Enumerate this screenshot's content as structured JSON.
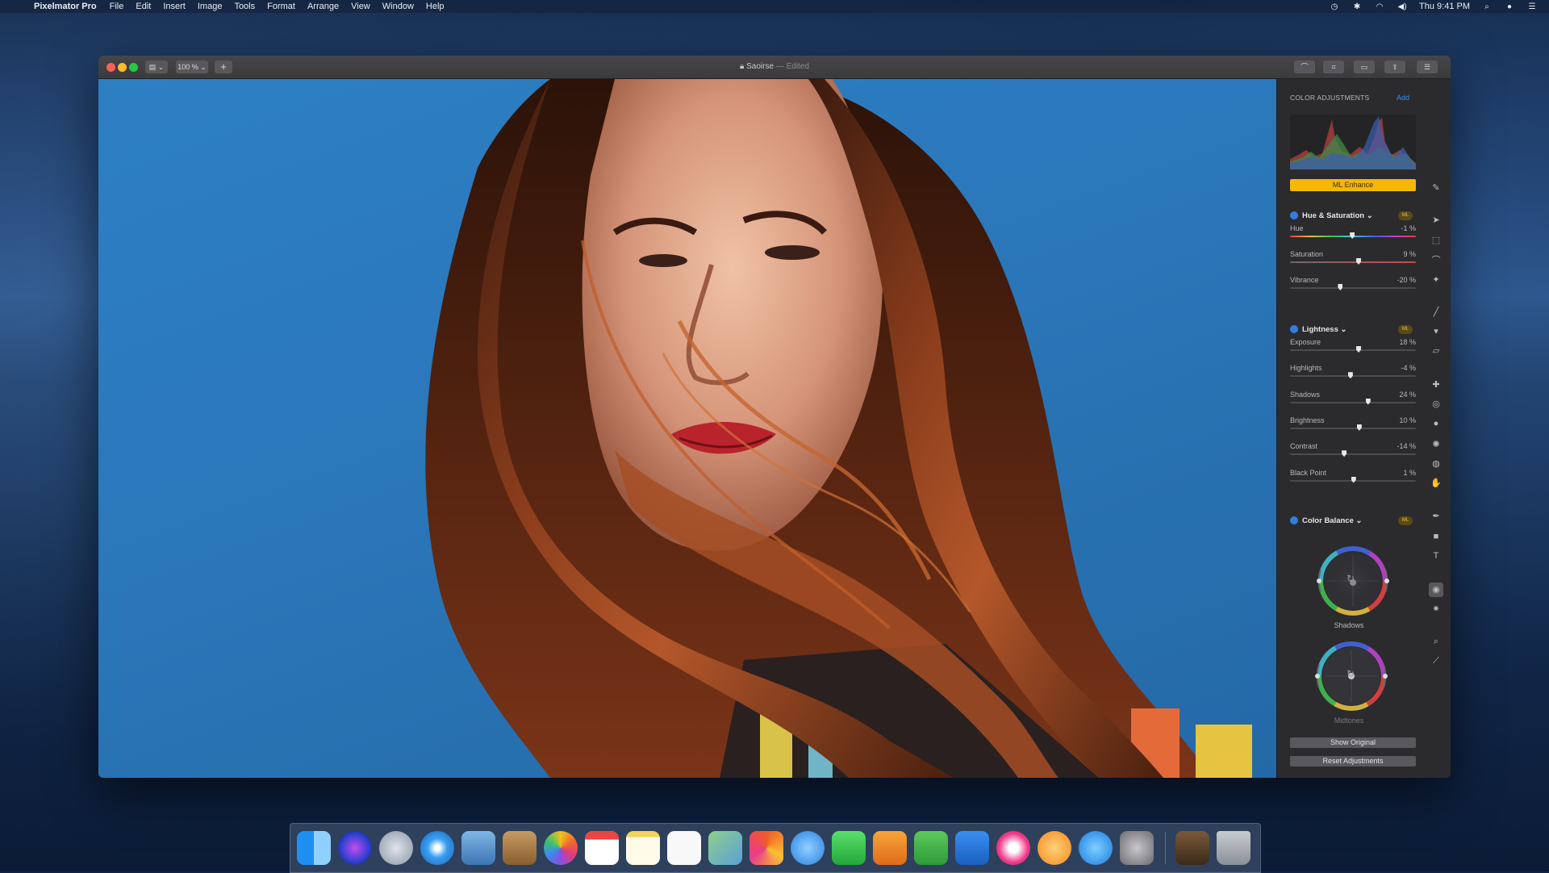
{
  "menubar": {
    "app_name": "Pixelmator Pro",
    "items": [
      "File",
      "Edit",
      "Insert",
      "Image",
      "Tools",
      "Format",
      "Arrange",
      "View",
      "Window",
      "Help"
    ],
    "clock": "Thu 9:41 PM"
  },
  "window": {
    "zoom": "100 %",
    "title": "Saoirse",
    "title_status": "— Edited"
  },
  "panel": {
    "header": "COLOR ADJUSTMENTS",
    "add_label": "Add",
    "ml_enhance": "ML Enhance",
    "hue_saturation": {
      "title": "Hue & Saturation ⌄",
      "badge": "ML",
      "sliders": [
        {
          "label": "Hue",
          "value": "-1 %",
          "pos": 0.495
        },
        {
          "label": "Saturation",
          "value": "9 %",
          "pos": 0.545
        },
        {
          "label": "Vibrance",
          "value": "-20 %",
          "pos": 0.4
        }
      ]
    },
    "lightness": {
      "title": "Lightness ⌄",
      "badge": "ML",
      "sliders": [
        {
          "label": "Exposure",
          "value": "18 %",
          "pos": 0.545
        },
        {
          "label": "Highlights",
          "value": "-4 %",
          "pos": 0.48
        },
        {
          "label": "Shadows",
          "value": "24 %",
          "pos": 0.62
        },
        {
          "label": "Brightness",
          "value": "10 %",
          "pos": 0.55
        },
        {
          "label": "Contrast",
          "value": "-14 %",
          "pos": 0.43
        },
        {
          "label": "Black Point",
          "value": "1 %",
          "pos": 0.505
        }
      ]
    },
    "color_balance": {
      "title": "Color Balance ⌄",
      "badge": "ML",
      "wheels": [
        "Shadows",
        "Midtones"
      ]
    },
    "show_original": "Show Original",
    "reset": "Reset Adjustments"
  }
}
